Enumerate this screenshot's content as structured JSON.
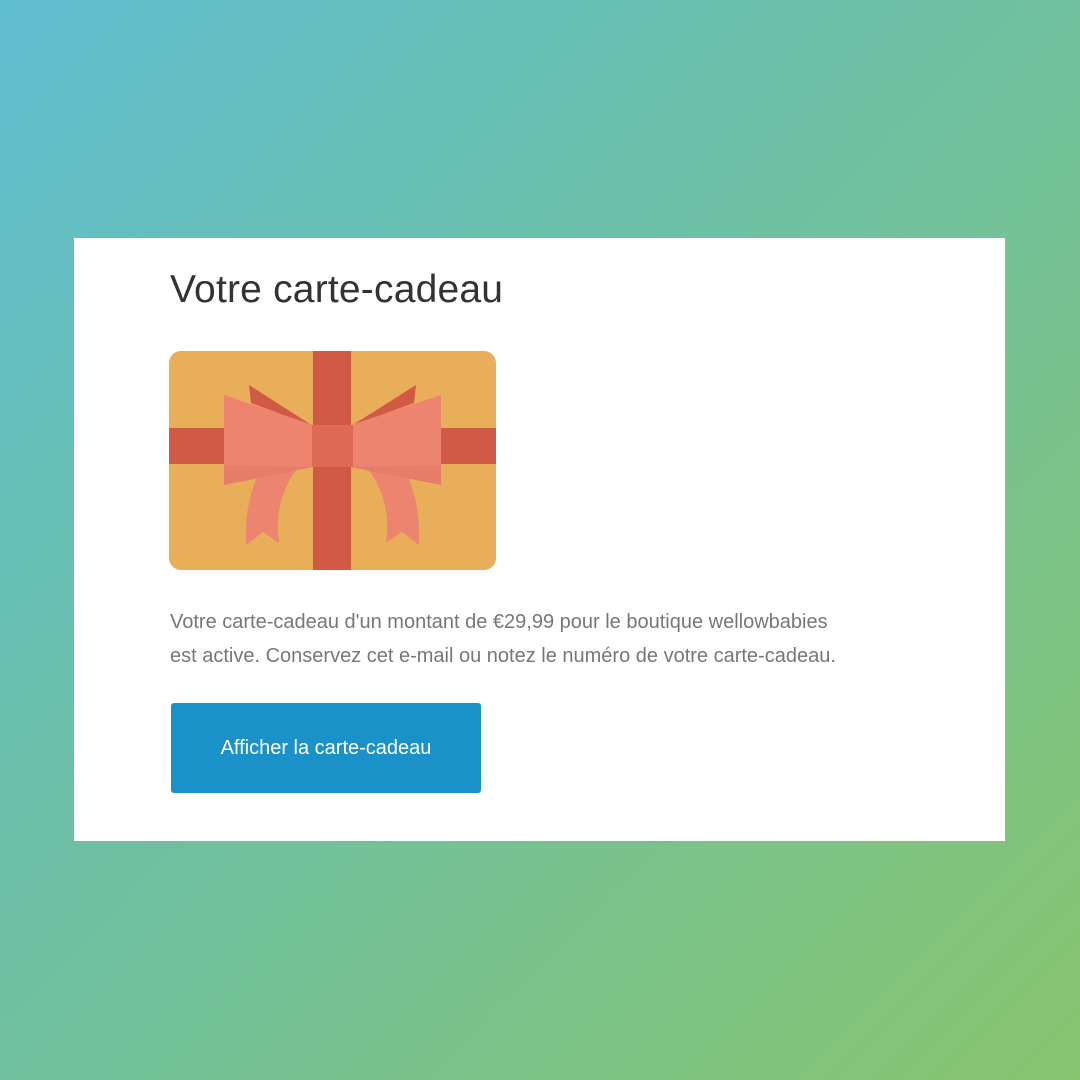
{
  "email": {
    "title": "Votre carte-cadeau",
    "message_line_1": "Votre carte-cadeau d'un montant de €29,99 pour le boutique wellowbabies",
    "message_line_2": "est active. Conservez cet e-mail ou notez le numéro de votre carte-cadeau.",
    "button_label": "Afficher la carte-cadeau"
  },
  "illustration": {
    "icon": "gift-card-icon",
    "card_color": "#e9ae59",
    "ribbon_color": "#d05a45",
    "bow_color": "#ec8470"
  },
  "colors": {
    "button": "#1a91c8",
    "background_gradient_start": "#5fbdd0",
    "background_gradient_end": "#86c46e"
  }
}
